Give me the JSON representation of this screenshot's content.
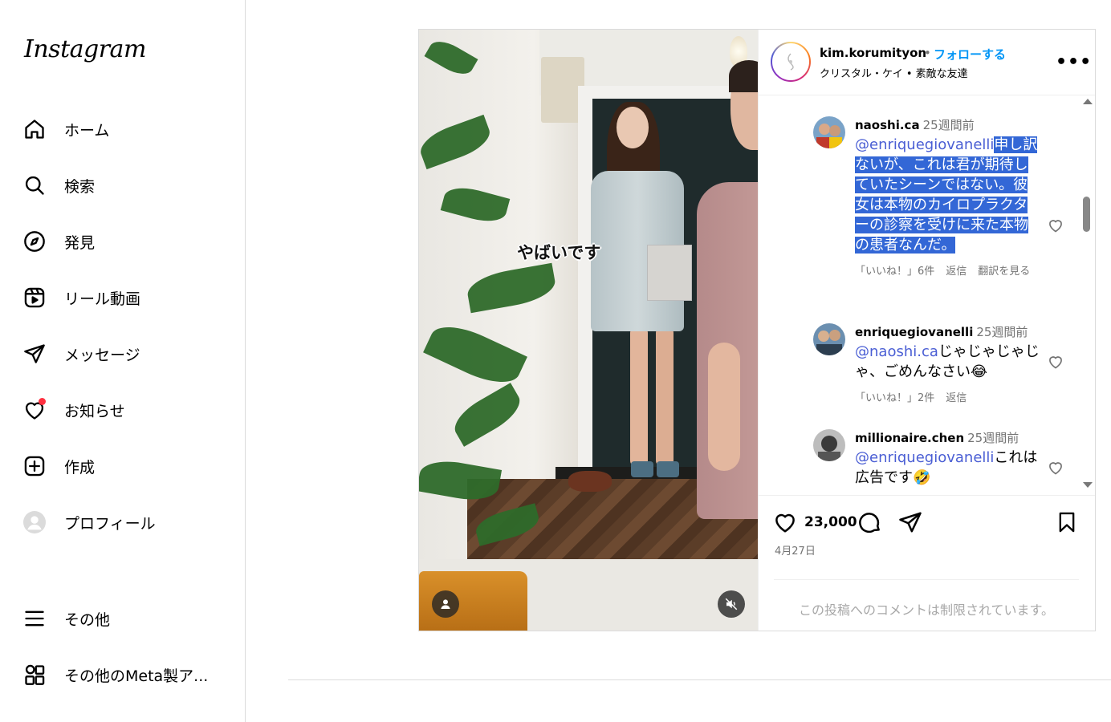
{
  "sidebar": {
    "logo": "Instagram",
    "items": [
      {
        "label": "ホーム",
        "icon": "home-icon"
      },
      {
        "label": "検索",
        "icon": "search-icon"
      },
      {
        "label": "発見",
        "icon": "compass-icon"
      },
      {
        "label": "リール動画",
        "icon": "reels-icon"
      },
      {
        "label": "メッセージ",
        "icon": "paper-plane-icon"
      },
      {
        "label": "お知らせ",
        "icon": "heart-icon"
      },
      {
        "label": "作成",
        "icon": "plus-square-icon"
      },
      {
        "label": "プロフィール",
        "icon": "profile-avatar-icon"
      },
      {
        "label": "その他",
        "icon": "menu-icon"
      },
      {
        "label": "その他のMeta製ア...",
        "icon": "apps-grid-icon"
      }
    ]
  },
  "post": {
    "username": "kim.korumityon",
    "dot": "•",
    "follow_label": "フォローする",
    "subtitle": "クリスタル・ケイ • 素敵な友達",
    "more": "•••",
    "video_caption": "やばいです",
    "likes": "23,000",
    "date": "4月27日",
    "comments_restricted": "この投稿へのコメントは制限されています。"
  },
  "comments": [
    {
      "user": "naoshi.ca",
      "time": "25週間前",
      "mention": "@enriquegiovanelli",
      "text": "申し訳ないが、これは君が期待していたシーンではない。彼女は本物のカイロプラクターの診察を受けに来た本物の患者なんだ。",
      "likes": "「いいね！」6件",
      "reply": "返信",
      "translate": "翻訳を見る"
    },
    {
      "user": "enriquegiovanelli",
      "time": "25週間前",
      "mention": "@naoshi.ca",
      "text": "じゃじゃじゃじゃ、ごめんなさい😂",
      "likes": "「いいね！」2件",
      "reply": "返信"
    },
    {
      "user": "millionaire.chen",
      "time": "25週間前",
      "mention": "@enriquegiovanelli",
      "text": "これは広告です🤣"
    }
  ],
  "colors": {
    "accent": "#0095f6",
    "mention": "#4a5ed4",
    "selection": "#3367d6",
    "notification": "#ff3040"
  }
}
